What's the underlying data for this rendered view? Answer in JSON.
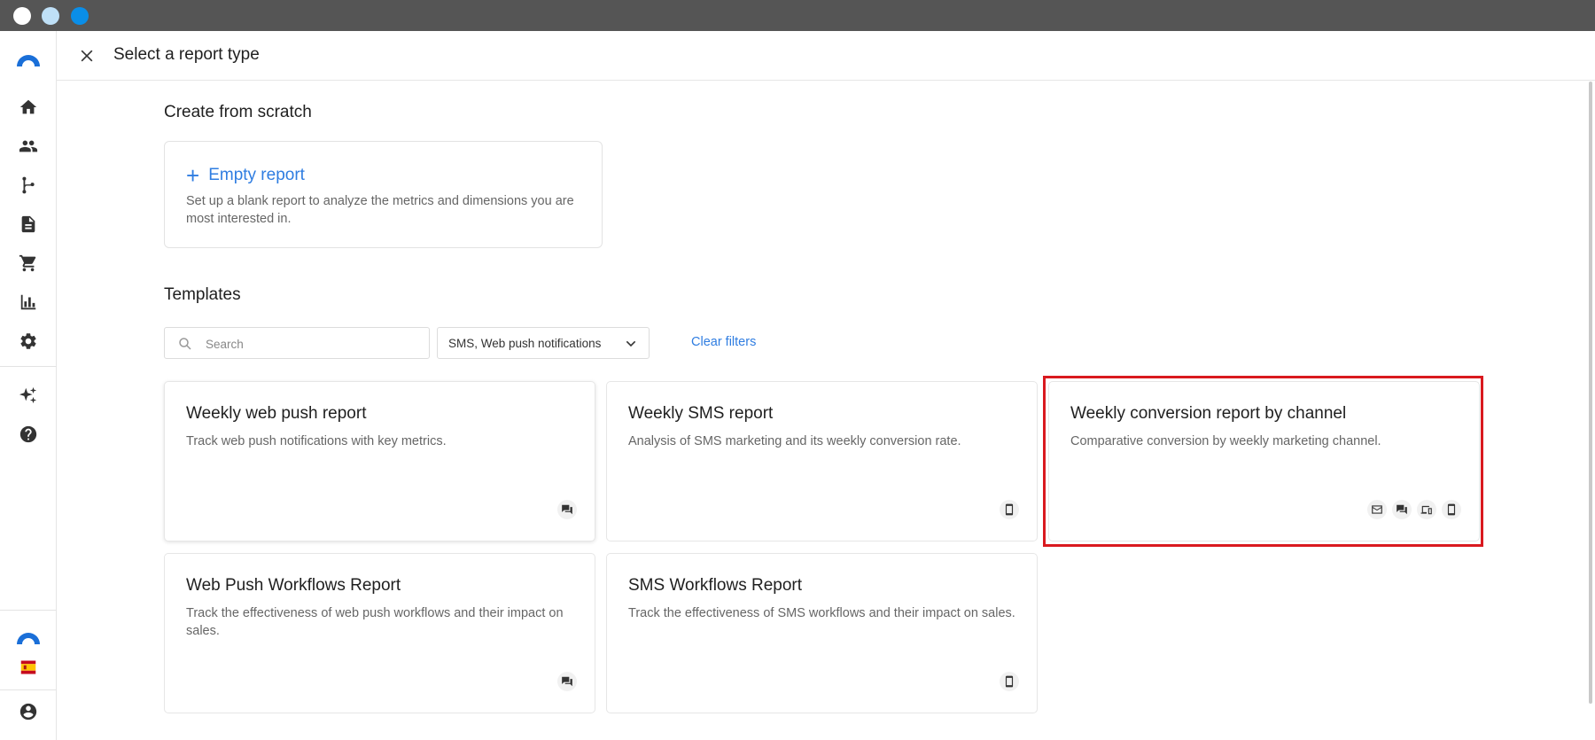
{
  "window": {
    "controls": [
      "close-dot",
      "minimize-dot",
      "maximize-dot"
    ],
    "control_colors": [
      "#ffffff",
      "#bfe0f7",
      "#0a8ee8"
    ]
  },
  "sidebar": {
    "items": [
      {
        "name": "home",
        "icon": "home-icon"
      },
      {
        "name": "contacts",
        "icon": "people-icon"
      },
      {
        "name": "workflows",
        "icon": "flow-branch-icon"
      },
      {
        "name": "documents",
        "icon": "document-icon"
      },
      {
        "name": "ecommerce",
        "icon": "cart-icon"
      },
      {
        "name": "reports",
        "icon": "bar-chart-icon"
      },
      {
        "name": "settings",
        "icon": "gear-icon"
      },
      {
        "name": "ai",
        "icon": "sparkles-icon"
      },
      {
        "name": "help",
        "icon": "help-circle-icon"
      }
    ],
    "bottom": [
      {
        "name": "brand",
        "icon": "brand-logo-icon"
      },
      {
        "name": "language",
        "icon": "spain-flag-icon"
      },
      {
        "name": "account",
        "icon": "account-circle-icon"
      }
    ]
  },
  "header": {
    "close_icon": "close-icon",
    "title": "Select a report type"
  },
  "scratch": {
    "section_title": "Create from scratch",
    "card_title": "Empty report",
    "card_desc": "Set up a blank report to analyze the metrics and dimensions you are most interested in."
  },
  "templates": {
    "section_title": "Templates",
    "search_placeholder": "Search",
    "filter_value": "SMS, Web push notifications",
    "clear_filters": "Clear filters",
    "cards": [
      {
        "title": "Weekly web push report",
        "desc": "Track web push notifications with key metrics.",
        "channels": [
          "chat-icon"
        ]
      },
      {
        "title": "Weekly SMS report",
        "desc": "Analysis of SMS marketing and its weekly conversion rate.",
        "channels": [
          "mobile-phone-icon"
        ]
      },
      {
        "title": "Weekly conversion report by channel",
        "desc": "Comparative conversion by weekly marketing channel.",
        "channels": [
          "mail-icon",
          "chat-icon",
          "devices-icon",
          "mobile-phone-icon"
        ]
      },
      {
        "title": "Web Push Workflows Report",
        "desc": "Track the effectiveness of web push workflows and their impact on sales.",
        "channels": [
          "chat-icon"
        ]
      },
      {
        "title": "SMS Workflows Report",
        "desc": "Track the effectiveness of SMS workflows and their impact on sales.",
        "channels": [
          "mobile-phone-icon"
        ]
      }
    ]
  },
  "colors": {
    "accent": "#2f7de1",
    "highlight": "#d9191f",
    "titlebar": "#555555"
  }
}
